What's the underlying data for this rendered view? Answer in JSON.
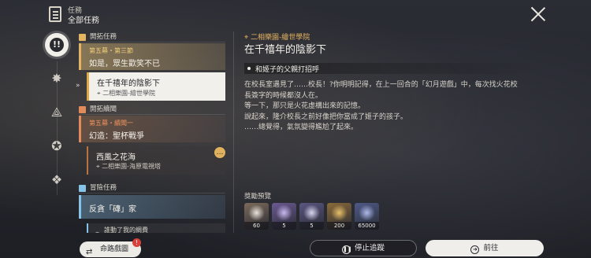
{
  "header": {
    "small_label": "任務",
    "title": "全部任務"
  },
  "rail": {
    "icons": [
      "exclamation-icon",
      "gear-diamond-icon",
      "triangle-icon",
      "star-icon",
      "diamond-icon"
    ]
  },
  "quest_list": {
    "sections": [
      {
        "label": "開拓任務",
        "color": "#e3b462"
      },
      {
        "label": "開拓續聞",
        "color": "#e38a5a"
      },
      {
        "label": "冒險任務",
        "color": "#86c3e8"
      }
    ],
    "trailblaze_card": {
      "chapter": "第五幕・第三節",
      "title": "如是，眾生歡笑不已"
    },
    "active_card": {
      "title": "在千禧年的陰影下",
      "location": "二相樂園-繪世學院"
    },
    "continuance_card": {
      "chapter": "第五幕・續聞一",
      "title": "幻造：聖杯戰爭"
    },
    "sub_card": {
      "title": "西風之花海",
      "location": "二相樂園-海原電視塔"
    },
    "adventure_card": {
      "title": "反貪「磚」家"
    },
    "peek_card": {
      "title": "誰動了我的綢費"
    }
  },
  "detail": {
    "location": "二相樂園-繪世學院",
    "title": "在千禧年的陰影下",
    "objective": "和姬子的父親打招呼",
    "description_lines": [
      "在校長室遇見了……校長！?你明明記得，在上一回合的「幻月遊戲」中，每次找火花校",
      "長簽字的時候都沒人在。",
      "等一下，那只是火花虛構出來的記憶。",
      "說起來，隆介校長之前好像把你當成了姬子的孩子。",
      "……總覺得，氣氛變得尷尬了起來。"
    ]
  },
  "rewards": {
    "label": "獎勵預覽",
    "items": [
      {
        "count": "60",
        "color": "#7c6a5a",
        "glow": "#e9e3dc"
      },
      {
        "count": "5",
        "color": "#6a5a92",
        "glow": "#c9b8f0"
      },
      {
        "count": "5",
        "color": "#5a5682",
        "glow": "#d8d6ee"
      },
      {
        "count": "200",
        "color": "#8a6a3a",
        "glow": "#e7c06a"
      },
      {
        "count": "65000",
        "color": "#4e5a88",
        "glow": "#aeb9e8"
      }
    ]
  },
  "buttons": {
    "map": "命路戲圖",
    "map_badge": "!",
    "stop": "停止追蹤",
    "go": "前往"
  }
}
